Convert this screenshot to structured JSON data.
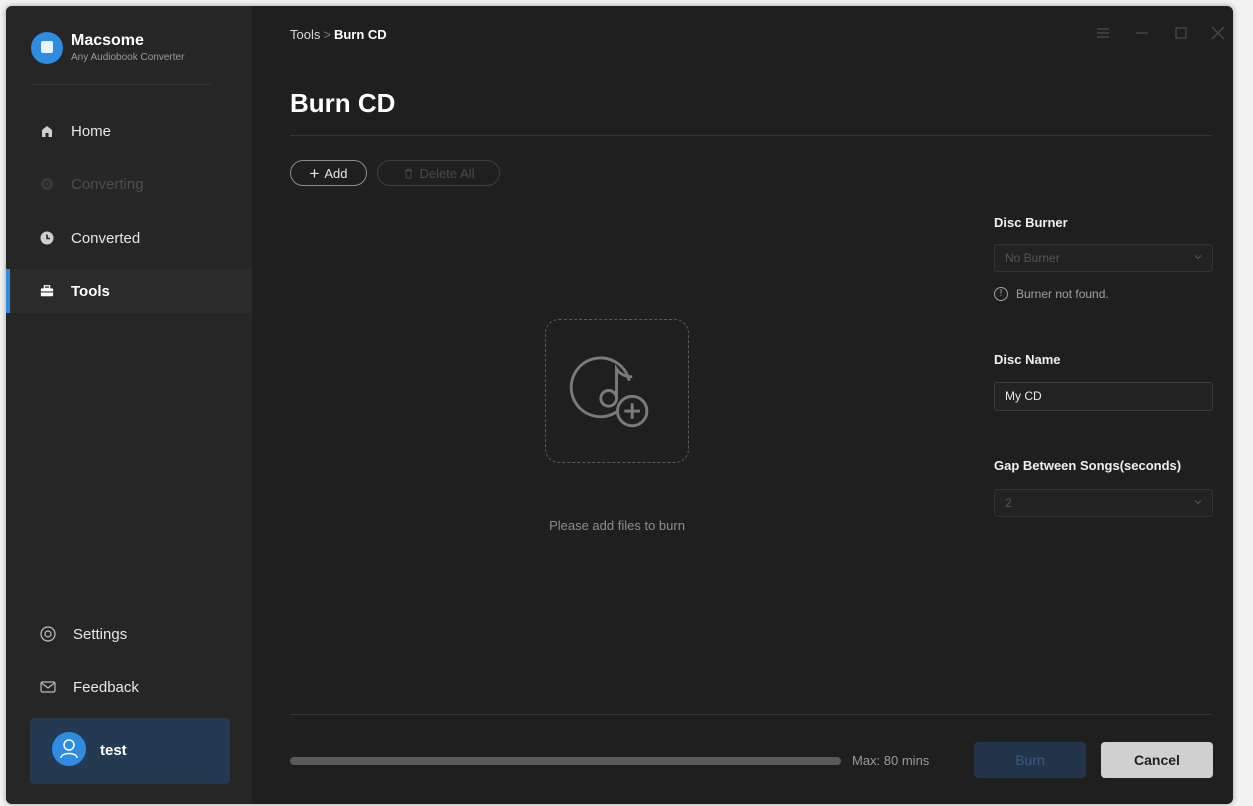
{
  "app": {
    "name": "Macsome",
    "subtitle": "Any Audiobook Converter"
  },
  "sidebar": {
    "items": [
      {
        "label": "Home",
        "icon": "home-icon",
        "state": "normal"
      },
      {
        "label": "Converting",
        "icon": "converting-icon",
        "state": "disabled"
      },
      {
        "label": "Converted",
        "icon": "clock-icon",
        "state": "normal"
      },
      {
        "label": "Tools",
        "icon": "toolbox-icon",
        "state": "active"
      }
    ],
    "bottom_items": [
      {
        "label": "Settings",
        "icon": "settings-icon"
      },
      {
        "label": "Feedback",
        "icon": "mail-icon"
      }
    ],
    "user": {
      "name": "test"
    }
  },
  "header": {
    "breadcrumb_parent": "Tools",
    "breadcrumb_sep": ">",
    "breadcrumb_current": "Burn CD"
  },
  "main": {
    "title": "Burn CD",
    "add_label": "Add",
    "delete_all_label": "Delete All",
    "drop_text": "Please add files to burn"
  },
  "settings": {
    "disc_burner_label": "Disc Burner",
    "disc_burner_value": "No Burner",
    "burner_warning": "Burner not found.",
    "disc_name_label": "Disc Name",
    "disc_name_value": "My CD",
    "gap_label": "Gap Between Songs(seconds)",
    "gap_value": "2"
  },
  "footer": {
    "progress_fraction": 0,
    "max_label": "Max: 80 mins",
    "burn_label": "Burn",
    "cancel_label": "Cancel"
  },
  "colors": {
    "accent": "#2f8ce0",
    "background": "#1f1f1f",
    "sidebar": "#262626"
  }
}
